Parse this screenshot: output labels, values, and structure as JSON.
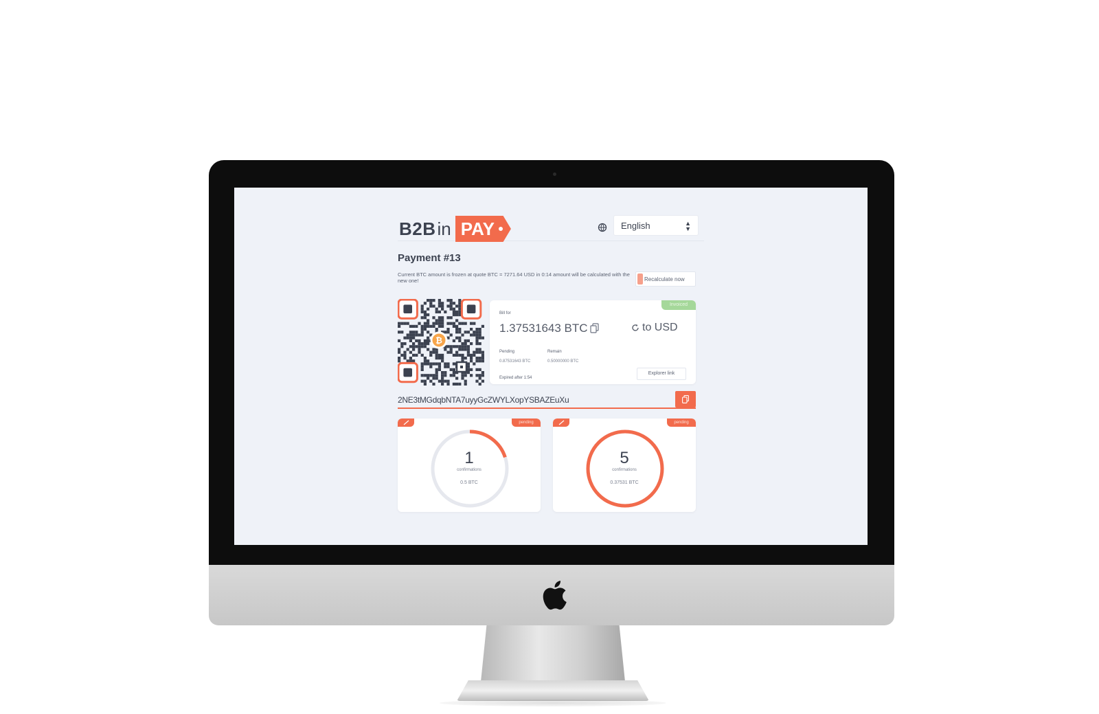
{
  "header": {
    "logo": {
      "part1": "B2B",
      "part2": "in",
      "part3": "PAY"
    },
    "language": "English"
  },
  "payment": {
    "title": "Payment #13",
    "notice": "Current BTC amount is frozen at quote BTC = 7271.64 USD in 0:14 amount will be calculated with the new one!",
    "recalculate_label": "Recalculate now",
    "status": "Invoiced",
    "bill_label": "Bill for",
    "amount": "1.37531643 BTC",
    "convert_label": "to USD",
    "pending_label": "Pending",
    "pending_value": "0.87531643 BTC",
    "remain_label": "Remain",
    "remain_value": "0.50000000 BTC",
    "expires_label": "Expired after 1:54",
    "explorer_label": "Explorer link",
    "address": "2NE3tMGdqbNTA7uyyGcZWYLXopYSBAZEuXu"
  },
  "confirmations": [
    {
      "count": "1",
      "label": "confirmations",
      "btc": "0.5 BTC",
      "status": "pending",
      "progress": 0.2
    },
    {
      "count": "5",
      "label": "confirmations",
      "btc": "0.37531 BTC",
      "status": "pending",
      "progress": 1.0
    }
  ],
  "colors": {
    "accent": "#f26b4c",
    "text": "#3c4250",
    "screen_bg": "#eff2f8",
    "status_green": "#a5d89a"
  },
  "icons": {
    "globe": "globe-icon",
    "copy": "copy-icon",
    "refresh": "refresh-icon",
    "bitcoin": "bitcoin-icon",
    "link": "link-icon",
    "apple": "apple-logo-icon"
  }
}
